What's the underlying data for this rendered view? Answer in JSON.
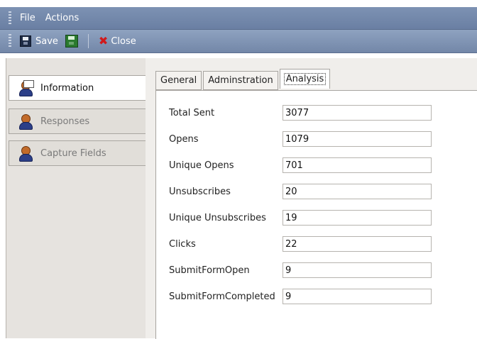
{
  "menubar": {
    "items": [
      "File",
      "Actions"
    ]
  },
  "toolbar": {
    "save_label": "Save",
    "close_label": "Close"
  },
  "nav": {
    "items": [
      {
        "label": "Information",
        "active": true
      },
      {
        "label": "Responses",
        "active": false
      },
      {
        "label": "Capture Fields",
        "active": false
      }
    ]
  },
  "tabs": [
    {
      "label": "General"
    },
    {
      "label": "Adminstration"
    },
    {
      "label": "Analysis"
    }
  ],
  "analysis": {
    "fields": [
      {
        "label": "Total Sent",
        "value": "3077"
      },
      {
        "label": "Opens",
        "value": "1079"
      },
      {
        "label": "Unique Opens",
        "value": "701"
      },
      {
        "label": "Unsubscribes",
        "value": "20"
      },
      {
        "label": "Unique Unsubscribes",
        "value": "19"
      },
      {
        "label": "Clicks",
        "value": "22"
      },
      {
        "label": "SubmitFormOpen",
        "value": "9"
      },
      {
        "label": "SubmitFormCompleted",
        "value": "9"
      }
    ]
  },
  "colors": {
    "menubar": "#7d92b3",
    "toolbar": "#8ea2c0",
    "close_icon": "#d1191b"
  }
}
